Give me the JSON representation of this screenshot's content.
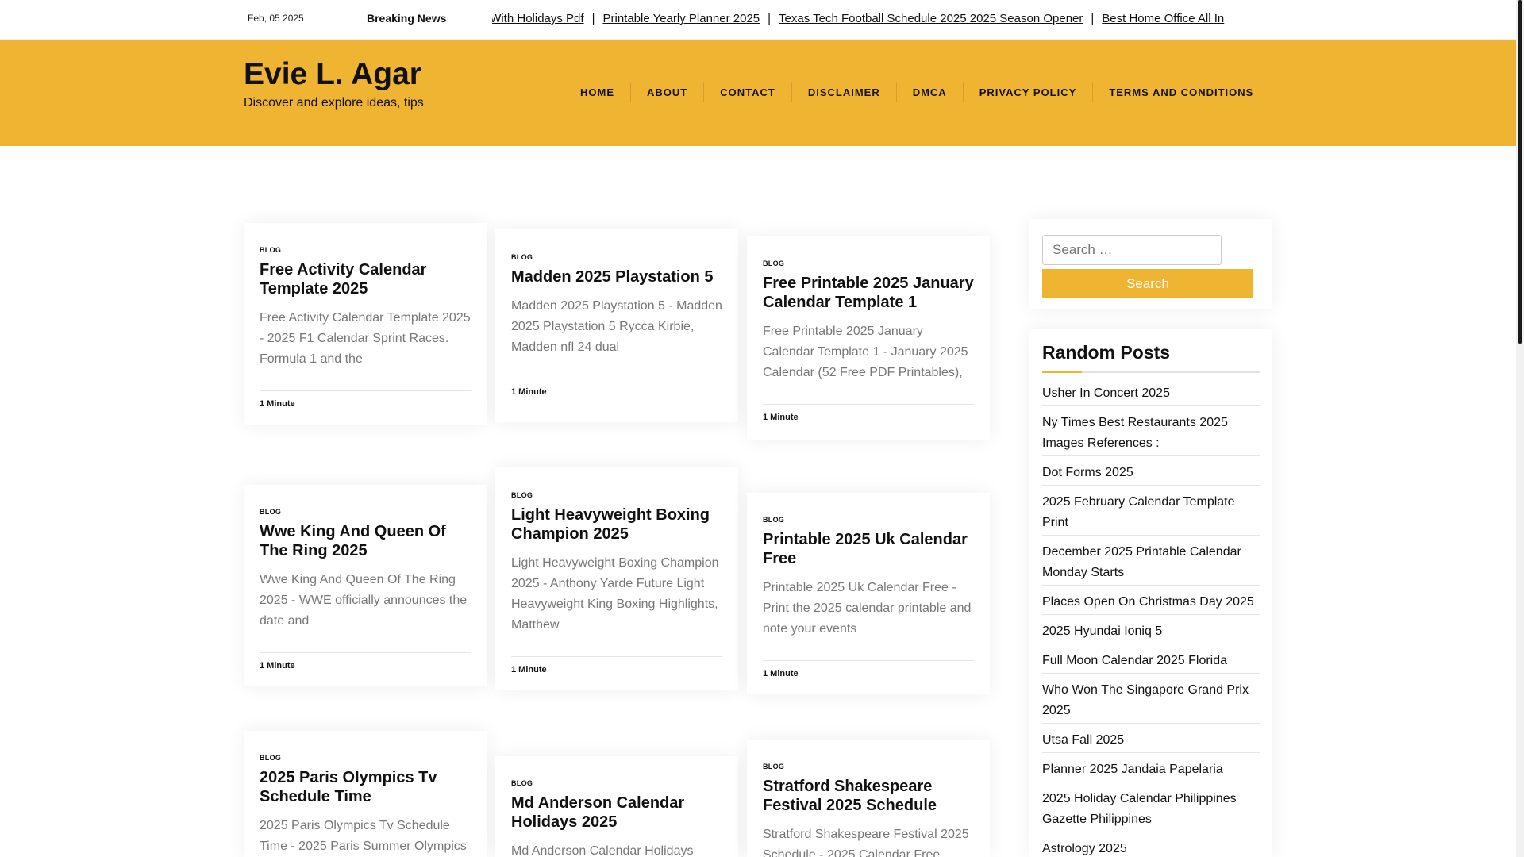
{
  "topbar": {
    "date": "Feb, 05 2025",
    "breaking_label": "Breaking News",
    "ticker": [
      "ndar With Holidays Pdf",
      "Printable Yearly Planner 2025",
      "Texas Tech Football Schedule 2025 2025 Season Opener",
      "Best Home Office All In"
    ],
    "separator": "|"
  },
  "header": {
    "site_title": "Evie L. Agar",
    "tagline": "Discover and explore ideas, tips",
    "accent_color": "#f0b433"
  },
  "nav": {
    "items": [
      "HOME",
      "ABOUT",
      "CONTACT",
      "DISCLAIMER",
      "DMCA",
      "PRIVACY POLICY",
      "TERMS AND CONDITIONS"
    ]
  },
  "posts": [
    {
      "category": "BLOG",
      "title": "Free Activity Calendar Template 2025",
      "excerpt": "Free Activity Calendar Template 2025 - 2025 F1 Calendar Sprint Races. Formula 1 and the",
      "read_time": "1 Minute"
    },
    {
      "category": "BLOG",
      "title": "Madden 2025 Playstation 5",
      "excerpt": "Madden 2025 Playstation 5 - Madden 2025 Playstation 5 Rycca Kirbie, Madden nfl 24 dual",
      "read_time": "1 Minute"
    },
    {
      "category": "BLOG",
      "title": "Free Printable 2025 January Calendar Template 1",
      "excerpt": "Free Printable 2025 January Calendar Template 1 - January 2025 Calendar (52 Free PDF Printables),",
      "read_time": "1 Minute"
    },
    {
      "category": "BLOG",
      "title": "Wwe King And Queen Of The Ring 2025",
      "excerpt": "Wwe King And Queen Of The Ring 2025 - WWE officially announces the date and",
      "read_time": "1 Minute"
    },
    {
      "category": "BLOG",
      "title": "Light Heavyweight Boxing Champion 2025",
      "excerpt": "Light Heavyweight Boxing Champion 2025 - Anthony Yarde Future Light Heavyweight King Boxing Highlights, Matthew",
      "read_time": "1 Minute"
    },
    {
      "category": "BLOG",
      "title": "Printable 2025 Uk Calendar Free",
      "excerpt": "Printable 2025 Uk Calendar Free - Print the 2025 calendar printable and note your events",
      "read_time": "1 Minute"
    },
    {
      "category": "BLOG",
      "title": "2025 Paris Olympics Tv Schedule Time",
      "excerpt": "2025 Paris Olympics Tv Schedule Time - 2025 Paris Summer Olympics",
      "read_time": ""
    },
    {
      "category": "BLOG",
      "title": "Md Anderson Calendar Holidays 2025",
      "excerpt": "Md Anderson Calendar Holidays",
      "read_time": ""
    },
    {
      "category": "BLOG",
      "title": "Stratford Shakespeare Festival 2025 Schedule",
      "excerpt": "Stratford Shakespeare Festival 2025 Schedule - 2025 Calendar Free",
      "read_time": ""
    }
  ],
  "sidebar": {
    "search_placeholder": "Search …",
    "search_button": "Search",
    "random_posts_title": "Random Posts",
    "random_posts": [
      "Usher In Concert 2025",
      "Ny Times Best Restaurants 2025 Images References :",
      "Dot Forms 2025",
      "2025 February Calendar Template Print",
      "December 2025 Printable Calendar Monday Starts",
      "Places Open On Christmas Day 2025",
      "2025 Hyundai Ioniq 5",
      "Full Moon Calendar 2025 Florida",
      "Who Won The Singapore Grand Prix 2025",
      "Utsa Fall 2025",
      "Planner 2025 Jandaia Papelaria",
      "2025 Holiday Calendar Philippines Gazette Philippines",
      "Astrology 2025"
    ]
  }
}
